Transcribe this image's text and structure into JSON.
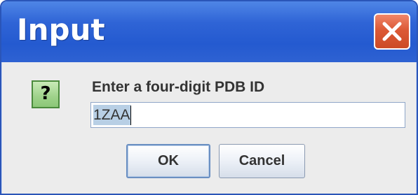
{
  "dialog": {
    "title": "Input",
    "close_icon": "close-x-icon",
    "prompt_icon": "question-icon",
    "prompt_icon_glyph": "?",
    "prompt": "Enter a four-digit PDB ID",
    "input_value": "1ZAA",
    "buttons": {
      "ok_label": "OK",
      "cancel_label": "Cancel"
    }
  },
  "colors": {
    "titlebar": "#2f64d6",
    "close_button": "#dc5a36",
    "question_icon_bg": "#9ed28a",
    "selection": "#b8cfe5"
  }
}
